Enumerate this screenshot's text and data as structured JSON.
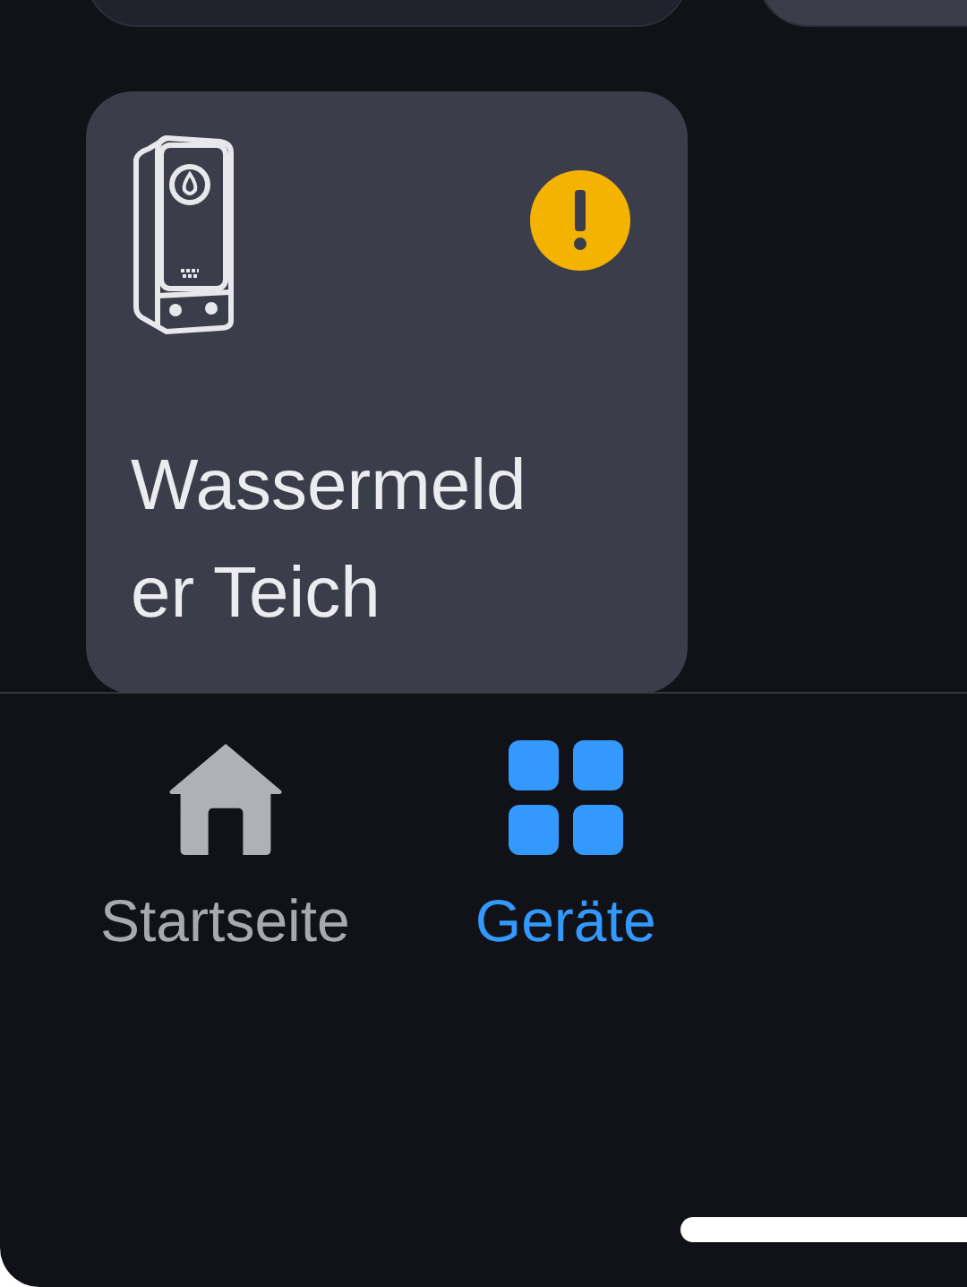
{
  "devices": [
    {
      "kind": "partial"
    },
    {
      "kind": "partial"
    },
    {
      "kind": "device",
      "name": "Wassermelder Teich",
      "warning": true
    }
  ],
  "nav": [
    {
      "label": "Startseite",
      "kind": "home",
      "selected": false
    },
    {
      "label": "Geräte",
      "kind": "grid",
      "selected": true
    }
  ]
}
